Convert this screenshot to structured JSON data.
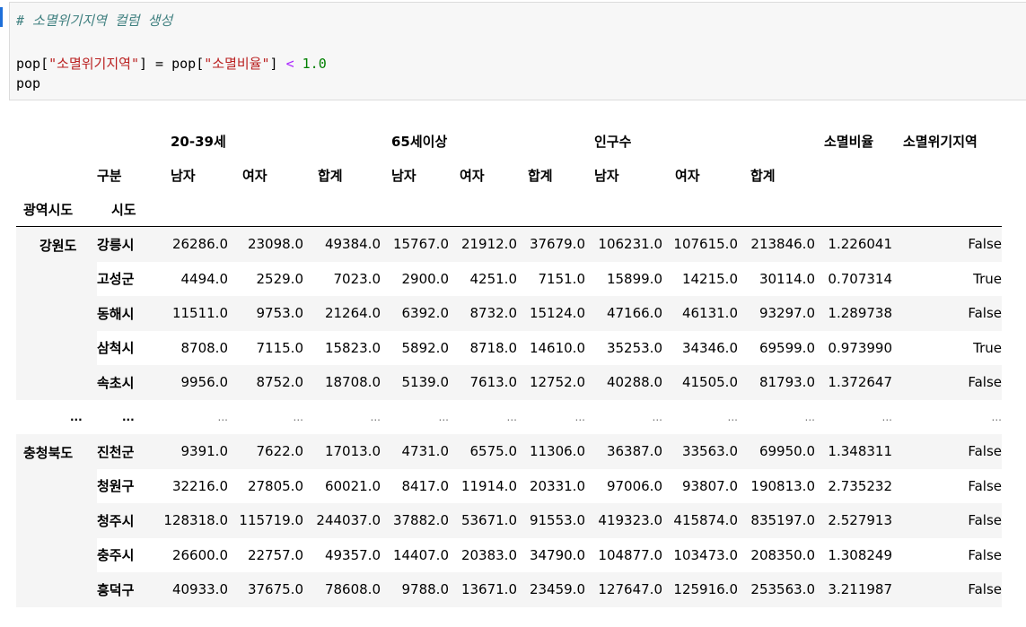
{
  "code_cell": {
    "comment": "# 소멸위기지역 컬럼 생성",
    "line2": {
      "var1": "pop[",
      "str1": "\"소멸위기지역\"",
      "close1": "] = ",
      "var2": "pop[",
      "str2": "\"소멸비율\"",
      "close2": "] ",
      "op": "<",
      "num": " 1.0"
    },
    "line3": "pop"
  },
  "table": {
    "header_row1": {
      "group1": "20-39세",
      "group2": "65세이상",
      "group3": "인구수",
      "col_ratio": "소멸비율",
      "col_risk": "소멸위기지역"
    },
    "header_row2": {
      "index_label": "구분",
      "male1": "남자",
      "female1": "여자",
      "total1": "합계",
      "male2": "남자",
      "female2": "여자",
      "total2": "합계",
      "male3": "남자",
      "female3": "여자",
      "total3": "합계"
    },
    "header_row3": {
      "level0": "광역시도",
      "level1": "시도"
    },
    "group_a": "강원도",
    "group_b": "충청북도",
    "ellipsis": "...",
    "rows": [
      {
        "level1": "강릉시",
        "v": [
          "26286.0",
          "23098.0",
          "49384.0",
          "15767.0",
          "21912.0",
          "37679.0",
          "106231.0",
          "107615.0",
          "213846.0",
          "1.226041",
          "False"
        ]
      },
      {
        "level1": "고성군",
        "v": [
          "4494.0",
          "2529.0",
          "7023.0",
          "2900.0",
          "4251.0",
          "7151.0",
          "15899.0",
          "14215.0",
          "30114.0",
          "0.707314",
          "True"
        ]
      },
      {
        "level1": "동해시",
        "v": [
          "11511.0",
          "9753.0",
          "21264.0",
          "6392.0",
          "8732.0",
          "15124.0",
          "47166.0",
          "46131.0",
          "93297.0",
          "1.289738",
          "False"
        ]
      },
      {
        "level1": "삼척시",
        "v": [
          "8708.0",
          "7115.0",
          "15823.0",
          "5892.0",
          "8718.0",
          "14610.0",
          "35253.0",
          "34346.0",
          "69599.0",
          "0.973990",
          "True"
        ]
      },
      {
        "level1": "속초시",
        "v": [
          "9956.0",
          "8752.0",
          "18708.0",
          "5139.0",
          "7613.0",
          "12752.0",
          "40288.0",
          "41505.0",
          "81793.0",
          "1.372647",
          "False"
        ]
      },
      {
        "level1": "진천군",
        "v": [
          "9391.0",
          "7622.0",
          "17013.0",
          "4731.0",
          "6575.0",
          "11306.0",
          "36387.0",
          "33563.0",
          "69950.0",
          "1.348311",
          "False"
        ]
      },
      {
        "level1": "청원구",
        "v": [
          "32216.0",
          "27805.0",
          "60021.0",
          "8417.0",
          "11914.0",
          "20331.0",
          "97006.0",
          "93807.0",
          "190813.0",
          "2.735232",
          "False"
        ]
      },
      {
        "level1": "청주시",
        "v": [
          "128318.0",
          "115719.0",
          "244037.0",
          "37882.0",
          "53671.0",
          "91553.0",
          "419323.0",
          "415874.0",
          "835197.0",
          "2.527913",
          "False"
        ]
      },
      {
        "level1": "충주시",
        "v": [
          "26600.0",
          "22757.0",
          "49357.0",
          "14407.0",
          "20383.0",
          "34790.0",
          "104877.0",
          "103473.0",
          "208350.0",
          "1.308249",
          "False"
        ]
      },
      {
        "level1": "흥덕구",
        "v": [
          "40933.0",
          "37675.0",
          "78608.0",
          "9788.0",
          "13671.0",
          "23459.0",
          "127647.0",
          "125916.0",
          "253563.0",
          "3.211987",
          "False"
        ]
      }
    ]
  }
}
